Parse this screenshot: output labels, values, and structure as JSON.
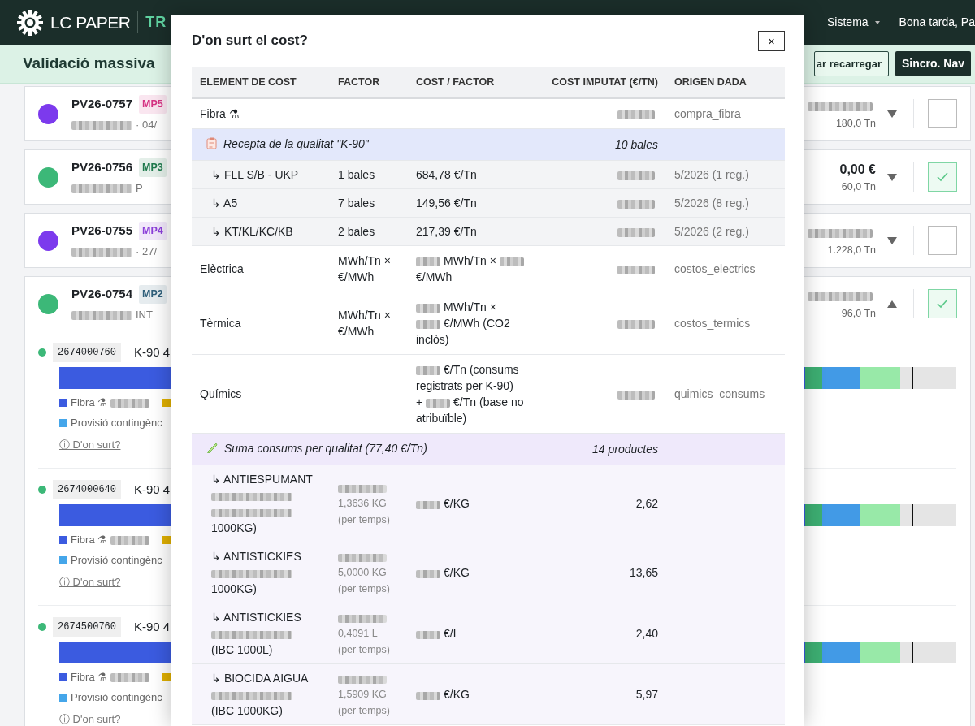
{
  "navbar": {
    "brand": "LC PAPER",
    "section": "TR",
    "menu": "Sistema",
    "greeting": "Bona tarda, Pa"
  },
  "header": {
    "title": "Validació massiva",
    "buttons": [
      {
        "label": "ar recarregar",
        "kind": "outline"
      },
      {
        "label": "Sincro. Nav",
        "kind": "dark"
      }
    ]
  },
  "orders": [
    {
      "id": "PV26-0757",
      "color": "#7c3aed",
      "badge": {
        "text": "MP5",
        "color": "#d63384"
      },
      "subtitle": [
        {
          "kind": "blurred"
        },
        "· 04/"
      ],
      "amount": [
        {
          "kind": "blurred"
        }
      ],
      "tonnage": "180,0 Tn",
      "expanded": false,
      "checked": false
    },
    {
      "id": "PV26-0756",
      "color": "#3cb878",
      "badge": {
        "text": "MP3",
        "color": "#1f7a4d"
      },
      "subtitle": [
        {
          "kind": "blurred"
        },
        "P"
      ],
      "amount": [
        "0,00 €"
      ],
      "tonnage": "60,0 Tn",
      "expanded": false,
      "checked": true
    },
    {
      "id": "PV26-0755",
      "color": "#7c3aed",
      "badge": {
        "text": "MP4",
        "color": "#8b3fd9"
      },
      "subtitle": [
        {
          "kind": "blurred"
        },
        "· 27/"
      ],
      "amount": [
        {
          "kind": "blurred"
        }
      ],
      "tonnage": "1.228,0 Tn",
      "expanded": false,
      "checked": false
    },
    {
      "id": "PV26-0754",
      "color": "#3cb878",
      "badge": {
        "text": "MP2",
        "color": "#2f5f7a"
      },
      "subtitle": [
        {
          "kind": "blurred"
        },
        "INT"
      ],
      "amount": [
        {
          "kind": "blurred"
        }
      ],
      "tonnage": "96,0 Tn",
      "expanded": true,
      "checked": true,
      "lines": [
        {
          "code": "2674000760",
          "product": "K-90 4",
          "fiber_label": "Fibra ⚗",
          "provision_label": "Provisió contingènc",
          "link": "ⓘ D'on surt?"
        },
        {
          "code": "2674000640",
          "product": "K-90 4",
          "fiber_label": "Fibra ⚗",
          "provision_label": "Provisió contingènc",
          "link": "ⓘ D'on surt?"
        },
        {
          "code": "2674500760",
          "product": "K-90 4",
          "fiber_label": "Fibra ⚗",
          "provision_label": "Provisió contingènc",
          "link": "ⓘ D'on surt?"
        }
      ]
    }
  ],
  "modal": {
    "title": "D'on surt el cost?",
    "close": "×",
    "columns": [
      "ELEMENT DE COST",
      "FACTOR",
      "COST / FACTOR",
      "COST IMPUTAT (€/TN)",
      "ORIGEN DADA"
    ],
    "rows": [
      {
        "kind": "main",
        "cells": [
          "Fibra ⚗",
          "—",
          "—",
          [
            [
              {
                "kind": "blurred"
              }
            ]
          ],
          "compra_fibra"
        ]
      },
      {
        "kind": "recipe_group",
        "label": "Recepta de la qualitat \"K-90\"",
        "count": "10 bales"
      },
      {
        "kind": "fiber_item",
        "cells": [
          "↳ FLL S/B - UKP",
          "1 bales",
          "684,78 €/Tn",
          [
            [
              {
                "kind": "blurred"
              }
            ]
          ],
          "5/2026 (1 reg.)"
        ]
      },
      {
        "kind": "fiber_item",
        "cells": [
          "↳ A5",
          "7 bales",
          "149,56 €/Tn",
          [
            [
              {
                "kind": "blurred"
              }
            ]
          ],
          "5/2026 (8 reg.)"
        ]
      },
      {
        "kind": "fiber_item",
        "cells": [
          "↳ KT/KL/KC/KB",
          "2 bales",
          "217,39 €/Tn",
          [
            [
              {
                "kind": "blurred"
              }
            ]
          ],
          "5/2026 (2 reg.)"
        ]
      },
      {
        "kind": "main",
        "cells": [
          "Elèctrica",
          "MWh/Tn × €/MWh",
          [
            [
              {
                "kind": "blurred"
              },
              "MWh/Tn ×",
              {
                "kind": "blurred"
              }
            ],
            [
              "€/MWh"
            ]
          ],
          [
            [
              {
                "kind": "blurred"
              }
            ]
          ],
          "costos_electrics"
        ]
      },
      {
        "kind": "main",
        "cells": [
          "Tèrmica",
          "MWh/Tn × €/MWh",
          [
            [
              {
                "kind": "blurred"
              },
              "MWh/Tn ×"
            ],
            [
              {
                "kind": "blurred"
              },
              "€/MWh (CO2"
            ],
            [
              "inclòs)"
            ]
          ],
          [
            [
              {
                "kind": "blurred"
              }
            ]
          ],
          "costos_termics"
        ]
      },
      {
        "kind": "main",
        "cells": [
          "Químics",
          "—",
          [
            [
              {
                "kind": "blurred"
              },
              "€/Tn (consums"
            ],
            [
              "registrats per K-90)"
            ],
            [
              "+",
              {
                "kind": "blurred"
              },
              "€/Tn (base no"
            ],
            [
              "atribuïble)"
            ]
          ],
          [
            [
              {
                "kind": "blurred"
              }
            ]
          ],
          "quimics_consums"
        ]
      },
      {
        "kind": "consumption_group",
        "label": "Suma consums per qualitat (77,40 €/Tn)",
        "count": "14 productes"
      },
      {
        "kind": "chemical_item",
        "cells": [
          [
            [
              "↳ ANTIESPUMANT"
            ],
            [
              {
                "kind": "blurred"
              }
            ],
            [
              {
                "kind": "blurred"
              }
            ],
            [
              "1000KG)"
            ]
          ],
          [
            [
              {
                "kind": "blurred"
              }
            ],
            [
              "1,3636 KG"
            ],
            [
              "(per temps)"
            ]
          ],
          [
            [
              {
                "kind": "blurred"
              },
              "€/KG"
            ]
          ],
          "2,62",
          ""
        ]
      },
      {
        "kind": "chemical_item",
        "cells": [
          [
            [
              "↳ ANTISTICKIES"
            ],
            [
              {
                "kind": "blurred"
              }
            ],
            [
              "1000KG)"
            ]
          ],
          [
            [
              {
                "kind": "blurred"
              }
            ],
            [
              "5,0000 KG"
            ],
            [
              "(per temps)"
            ]
          ],
          [
            [
              {
                "kind": "blurred"
              },
              "€/KG"
            ]
          ],
          "13,65",
          ""
        ]
      },
      {
        "kind": "chemical_item",
        "cells": [
          [
            [
              "↳ ANTISTICKIES"
            ],
            [
              {
                "kind": "blurred"
              }
            ],
            [
              "(IBC 1000L)"
            ]
          ],
          [
            [
              {
                "kind": "blurred"
              }
            ],
            [
              "0,4091 L"
            ],
            [
              "(per temps)"
            ]
          ],
          [
            [
              {
                "kind": "blurred"
              },
              "€/L"
            ]
          ],
          "2,40",
          ""
        ]
      },
      {
        "kind": "chemical_item",
        "cells": [
          [
            [
              "↳ BIOCIDA AIGUA"
            ],
            [
              {
                "kind": "blurred"
              }
            ],
            [
              "(IBC 1000KG)"
            ]
          ],
          [
            [
              {
                "kind": "blurred"
              }
            ],
            [
              "1,5909 KG"
            ],
            [
              "(per temps)"
            ]
          ],
          [
            [
              {
                "kind": "blurred"
              },
              "€/KG"
            ]
          ],
          "5,97",
          ""
        ]
      }
    ]
  }
}
